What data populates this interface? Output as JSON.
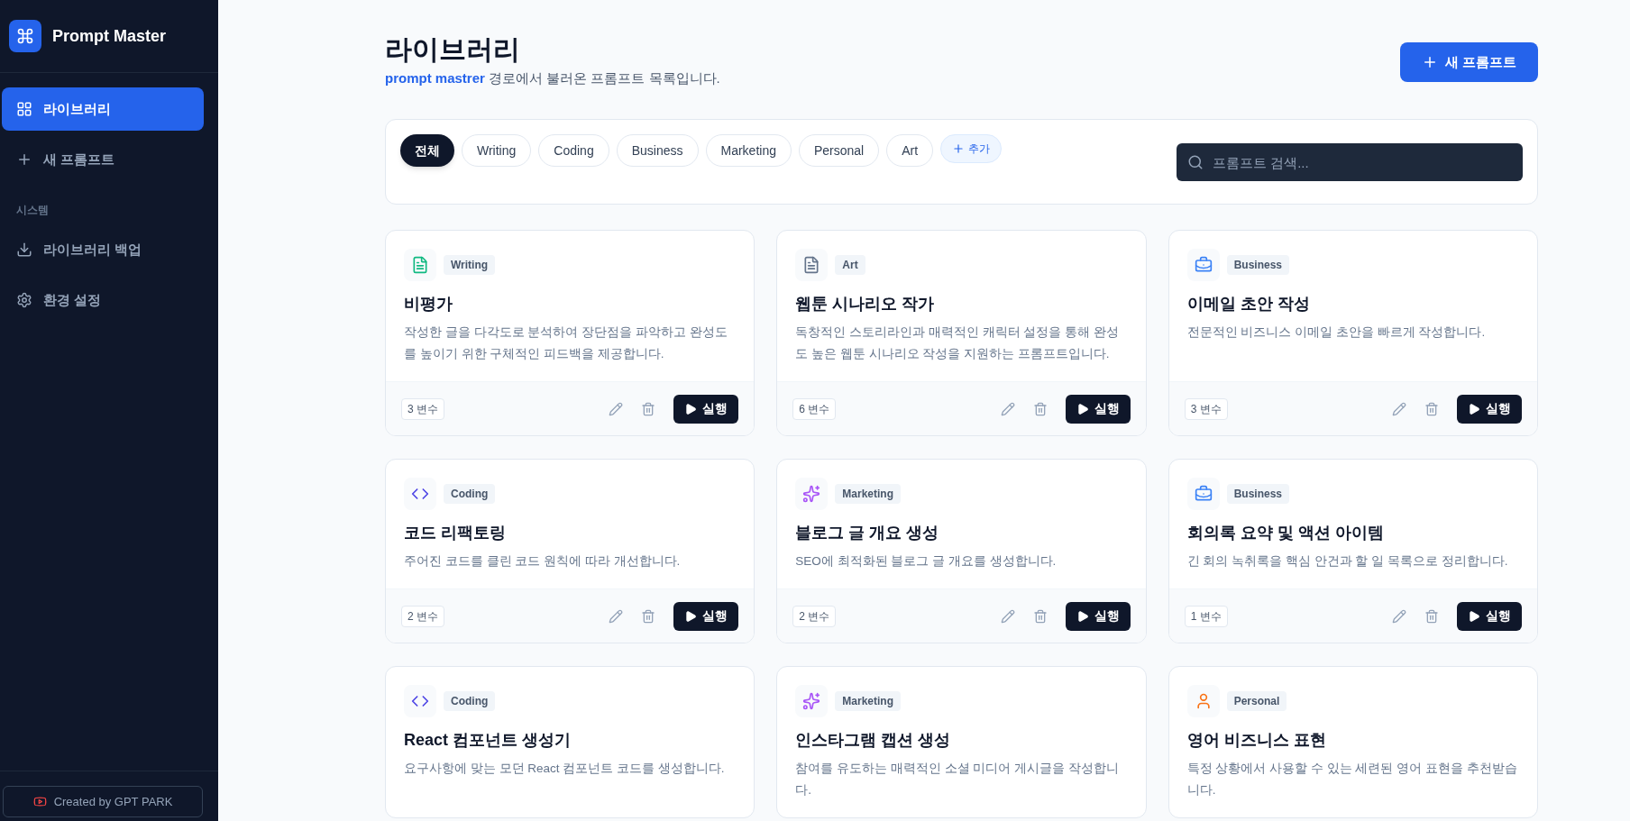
{
  "sidebar": {
    "app_name": "Prompt Master",
    "items": [
      {
        "label": "라이브러리",
        "kind": "grid",
        "selected": true
      },
      {
        "label": "새 프롬프트",
        "kind": "plus",
        "selected": false
      }
    ],
    "section_label": "시스템",
    "system_items": [
      {
        "label": "라이브러리 백업",
        "kind": "download"
      },
      {
        "label": "환경 설정",
        "kind": "gear"
      }
    ],
    "footer_button": "Created by GPT PARK"
  },
  "header": {
    "title": "라이브러리",
    "path": "prompt mastrer",
    "subtitle": "경로에서 불러온 프롬프트 목록입니다.",
    "new_button": "새 프롬프트"
  },
  "filters": [
    {
      "label": "전체",
      "selected": true
    },
    {
      "label": "Writing",
      "selected": false
    },
    {
      "label": "Coding",
      "selected": false
    },
    {
      "label": "Business",
      "selected": false
    },
    {
      "label": "Marketing",
      "selected": false
    },
    {
      "label": "Personal",
      "selected": false
    },
    {
      "label": "Art",
      "selected": false
    }
  ],
  "add_filter": "추가",
  "search": {
    "placeholder": "프롬프트 검색..."
  },
  "cards": [
    {
      "kind": "document",
      "color": "#10b981",
      "category": "Writing",
      "title": "비평가",
      "description": "작성한 글을 다각도로 분석하여 장단점을 파악하고 완성도를 높이기 위한 구체적인 피드백을 제공합니다.",
      "variables": "3 변수",
      "run": "실행"
    },
    {
      "kind": "document",
      "color": "#64748b",
      "category": "Art",
      "title": "웹툰 시나리오 작가",
      "description": "독창적인 스토리라인과 매력적인 캐릭터 설정을 통해 완성도 높은 웹툰 시나리오 작성을 지원하는 프롬프트입니다.",
      "variables": "6 변수",
      "run": "실행"
    },
    {
      "kind": "briefcase",
      "color": "#3b82f6",
      "category": "Business",
      "title": "이메일 초안 작성",
      "description": "전문적인 비즈니스 이메일 초안을 빠르게 작성합니다.",
      "variables": "3 변수",
      "run": "실행"
    },
    {
      "kind": "code",
      "color": "#4f46e5",
      "category": "Coding",
      "title": "코드 리팩토링",
      "description": "주어진 코드를 클린 코드 원칙에 따라 개선합니다.",
      "variables": "2 변수",
      "run": "실행"
    },
    {
      "kind": "sparkles",
      "color": "#a855f7",
      "category": "Marketing",
      "title": "블로그 글 개요 생성",
      "description": "SEO에 최적화된 블로그 글 개요를 생성합니다.",
      "variables": "2 변수",
      "run": "실행"
    },
    {
      "kind": "briefcase",
      "color": "#3b82f6",
      "category": "Business",
      "title": "회의록 요약 및 액션 아이템",
      "description": "긴 회의 녹취록을 핵심 안건과 할 일 목록으로 정리합니다.",
      "variables": "1 변수",
      "run": "실행"
    },
    {
      "kind": "code",
      "color": "#4f46e5",
      "category": "Coding",
      "title": "React 컴포넌트 생성기",
      "description": "요구사항에 맞는 모던 React 컴포넌트 코드를 생성합니다."
    },
    {
      "kind": "sparkles",
      "color": "#a855f7",
      "category": "Marketing",
      "title": "인스타그램 캡션 생성",
      "description": "참여를 유도하는 매력적인 소셜 미디어 게시글을 작성합니다."
    },
    {
      "kind": "user",
      "color": "#f97316",
      "category": "Personal",
      "title": "영어 비즈니스 표현",
      "description": "특정 상황에서 사용할 수 있는 세련된 영어 표현을 추천받습니다."
    }
  ]
}
